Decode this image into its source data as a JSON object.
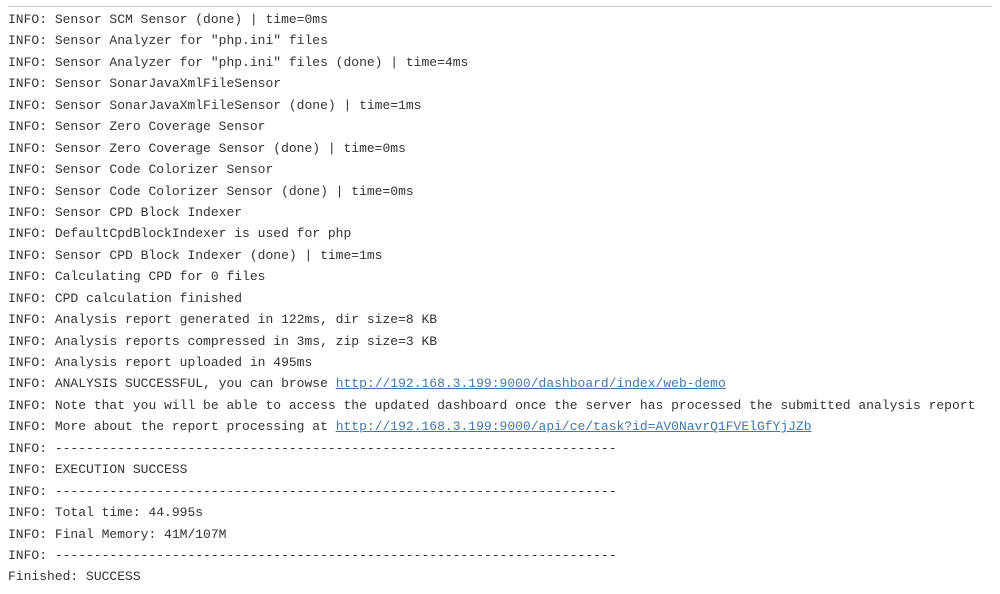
{
  "log": [
    {
      "prefix": "INFO:",
      "text": "Sensor SCM Sensor (done) | time=0ms"
    },
    {
      "prefix": "INFO:",
      "text": "Sensor Analyzer for \"php.ini\" files"
    },
    {
      "prefix": "INFO:",
      "text": "Sensor Analyzer for \"php.ini\" files (done) | time=4ms"
    },
    {
      "prefix": "INFO:",
      "text": "Sensor SonarJavaXmlFileSensor"
    },
    {
      "prefix": "INFO:",
      "text": "Sensor SonarJavaXmlFileSensor (done) | time=1ms"
    },
    {
      "prefix": "INFO:",
      "text": "Sensor Zero Coverage Sensor"
    },
    {
      "prefix": "INFO:",
      "text": "Sensor Zero Coverage Sensor (done) | time=0ms"
    },
    {
      "prefix": "INFO:",
      "text": "Sensor Code Colorizer Sensor"
    },
    {
      "prefix": "INFO:",
      "text": "Sensor Code Colorizer Sensor (done) | time=0ms"
    },
    {
      "prefix": "INFO:",
      "text": "Sensor CPD Block Indexer"
    },
    {
      "prefix": "INFO:",
      "text": "DefaultCpdBlockIndexer is used for php"
    },
    {
      "prefix": "INFO:",
      "text": "Sensor CPD Block Indexer (done) | time=1ms"
    },
    {
      "prefix": "INFO:",
      "text": "Calculating CPD for 0 files"
    },
    {
      "prefix": "INFO:",
      "text": "CPD calculation finished"
    },
    {
      "prefix": "INFO:",
      "text": "Analysis report generated in 122ms, dir size=8 KB"
    },
    {
      "prefix": "INFO:",
      "text": "Analysis reports compressed in 3ms, zip size=3 KB"
    },
    {
      "prefix": "INFO:",
      "text": "Analysis report uploaded in 495ms"
    },
    {
      "prefix": "INFO:",
      "text": "ANALYSIS SUCCESSFUL, you can browse ",
      "url": "http://192.168.3.199:9000/dashboard/index/web-demo"
    },
    {
      "prefix": "INFO:",
      "text": "Note that you will be able to access the updated dashboard once the server has processed the submitted analysis report"
    },
    {
      "prefix": "INFO:",
      "text": "More about the report processing at ",
      "url": "http://192.168.3.199:9000/api/ce/task?id=AV0NavrQ1FVElGfYjJZb"
    },
    {
      "prefix": "INFO:",
      "text": "------------------------------------------------------------------------"
    },
    {
      "prefix": "INFO:",
      "text": "EXECUTION SUCCESS"
    },
    {
      "prefix": "INFO:",
      "text": "------------------------------------------------------------------------"
    },
    {
      "prefix": "INFO:",
      "text": "Total time: 44.995s"
    },
    {
      "prefix": "INFO:",
      "text": "Final Memory: 41M/107M"
    },
    {
      "prefix": "INFO:",
      "text": "------------------------------------------------------------------------"
    },
    {
      "prefix": "Finished:",
      "text": "SUCCESS"
    }
  ]
}
